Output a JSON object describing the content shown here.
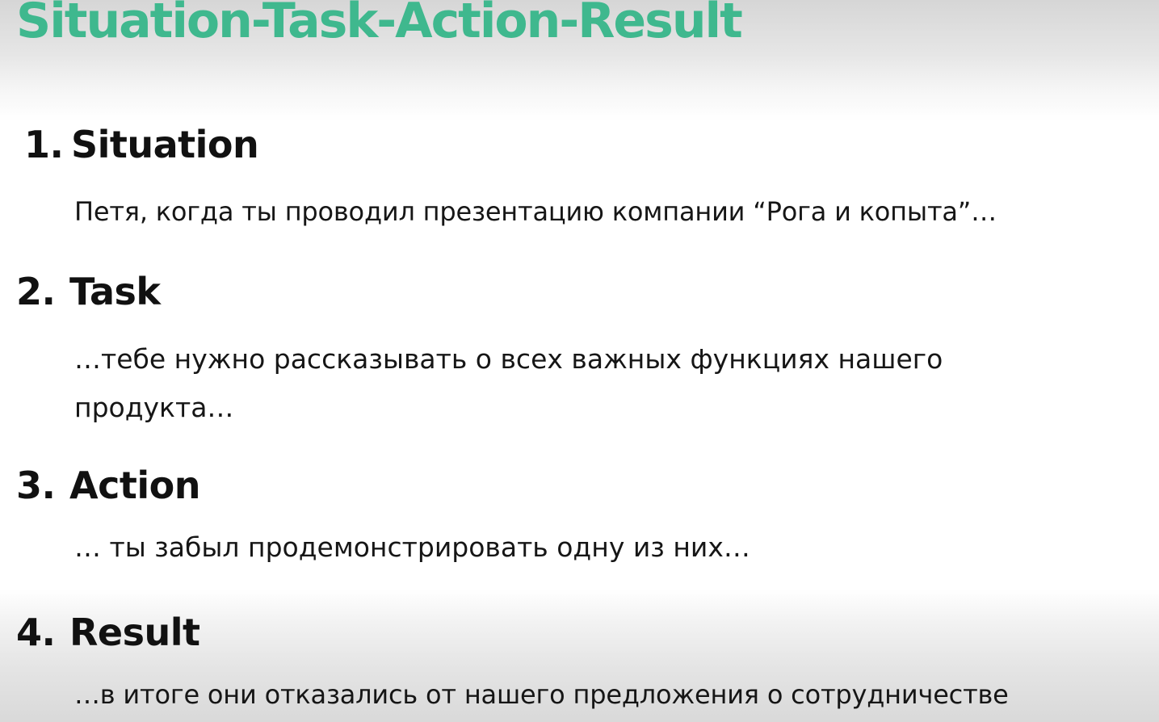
{
  "title": "Situation-Task-Action-Result",
  "items": [
    {
      "number": "1.",
      "heading": "Situation",
      "text": "Петя, когда ты проводил презентацию компании “Рога и копыта”…"
    },
    {
      "number": "2.",
      "heading": "Task",
      "text": "…тебе нужно рассказывать о всех важных функциях нашего продукта…"
    },
    {
      "number": "3.",
      "heading": "Action",
      "text": "… ты забыл продемонстрировать одну из них…"
    },
    {
      "number": "4.",
      "heading": "Result",
      "text": "…в итоге они отказались от нашего предложения о сотрудничестве"
    }
  ],
  "colors": {
    "title": "#3fb88e",
    "text": "#111111",
    "background": "#ffffff"
  }
}
